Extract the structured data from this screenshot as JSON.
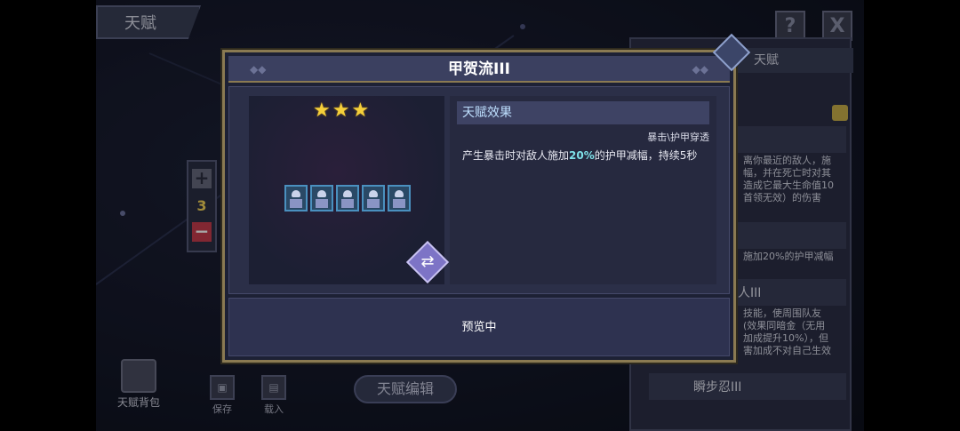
{
  "header": {
    "tab_talent": "天赋",
    "help_icon": "?",
    "close_icon": "X"
  },
  "right_panel": {
    "title": "天赋",
    "text_block_1": [
      "离你最近的敌人，施",
      "幅，并在死亡时对其",
      "造成它最大生命值10",
      "首领无效）的伤害"
    ],
    "text_block_2": "施加20%的护甲减幅",
    "row_2_label": "人III",
    "text_block_3": [
      "技能，使周围队友",
      "(效果同暗金（无用",
      "加成提升10%），但",
      "害加成不对自己生效"
    ],
    "row_bottom_label": "瞬步忍III"
  },
  "stepper": {
    "plus": "+",
    "count": "3",
    "minus": "−"
  },
  "bottom_bar": {
    "backpack_label": "天赋背包",
    "save_label": "保存",
    "load_label": "载入",
    "edit_label": "天赋编辑"
  },
  "modal": {
    "title": "甲贺流III",
    "stars": "★★★",
    "effect_header": "天赋效果",
    "effect_tag": "暴击\\护甲穿透",
    "effect_desc_prefix": "产生暴击时对敌人施加",
    "effect_desc_value": "20%",
    "effect_desc_suffix": "的护甲减幅，持续5秒",
    "footer_status": "预览中",
    "unit_count": 5,
    "swap_icon": "⇄"
  }
}
